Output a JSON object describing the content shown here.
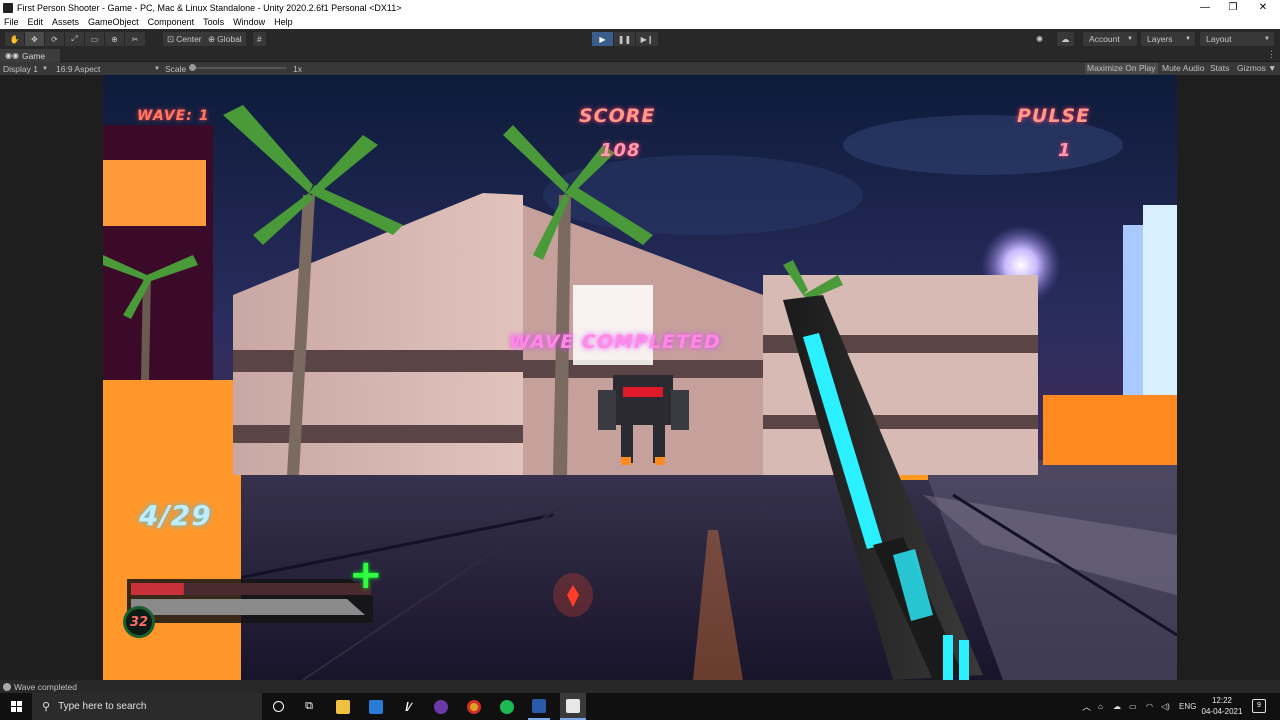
{
  "window": {
    "title": "First Person Shooter - Game - PC, Mac & Linux Standalone - Unity 2020.2.6f1 Personal <DX11>",
    "minimize": "—",
    "maximize": "❐",
    "close": "✕"
  },
  "menu": [
    "File",
    "Edit",
    "Assets",
    "GameObject",
    "Component",
    "Tools",
    "Window",
    "Help"
  ],
  "toolbar": {
    "tools": [
      "✋",
      "✥",
      "⟳",
      "⤢",
      "▭",
      "⊕",
      "✂"
    ],
    "pivot": "Center",
    "handle": "Global",
    "grid_icon": "#",
    "play": "▶",
    "pause": "❚❚",
    "step": "▶❙",
    "account": "Account",
    "layers": "Layers",
    "layout": "Layout"
  },
  "game_tab": {
    "label": "Game",
    "display": "Display 1",
    "aspect": "16:9 Aspect",
    "scale_label": "Scale",
    "scale_value": "1x",
    "maximize": "Maximize On Play",
    "mute": "Mute Audio",
    "stats": "Stats",
    "gizmos": "Gizmos"
  },
  "hud": {
    "wave": "WAVE: 1",
    "score_label": "SCORE",
    "score": "108",
    "pulse_label": "PULSE",
    "pulse": "1",
    "message": "WAVE COMPLETED",
    "ammo": "4/29",
    "health": "32",
    "health_fraction": 0.22,
    "heal_icon": "+"
  },
  "status": {
    "message": "Wave completed"
  },
  "taskbar": {
    "search_placeholder": "Type here to search",
    "language": "ENG",
    "time": "12:22",
    "date": "04-04-2021",
    "notifications": "9"
  },
  "colors": {
    "accent": "#3a5e8c",
    "hud_pink": "#ff9ab0",
    "hud_cyan": "#bfefff",
    "hud_magenta": "#ff8ae0",
    "health_green": "#30ff40"
  }
}
